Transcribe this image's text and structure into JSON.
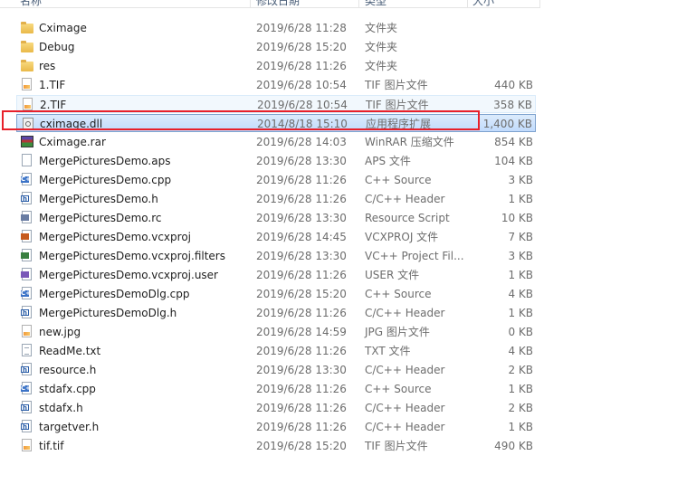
{
  "header": {
    "name": "名称",
    "date": "修改日期",
    "type": "类型",
    "size": "大小"
  },
  "files": [
    {
      "name": "Cximage",
      "date": "2019/6/28 11:28",
      "type": "文件夹",
      "size": "",
      "icon": "folder-icon"
    },
    {
      "name": "Debug",
      "date": "2019/6/28 15:20",
      "type": "文件夹",
      "size": "",
      "icon": "folder-icon"
    },
    {
      "name": "res",
      "date": "2019/6/28 11:26",
      "type": "文件夹",
      "size": "",
      "icon": "folder-icon"
    },
    {
      "name": "1.TIF",
      "date": "2019/6/28 10:54",
      "type": "TIF 图片文件",
      "size": "440 KB",
      "icon": "tif-image-icon"
    },
    {
      "name": "2.TIF",
      "date": "2019/6/28 10:54",
      "type": "TIF 图片文件",
      "size": "358 KB",
      "icon": "tif-image-icon"
    },
    {
      "name": "cximage.dll",
      "date": "2014/8/18 15:10",
      "type": "应用程序扩展",
      "size": "1,400 KB",
      "icon": "dll-icon"
    },
    {
      "name": "Cximage.rar",
      "date": "2019/6/28 14:03",
      "type": "WinRAR 压缩文件",
      "size": "854 KB",
      "icon": "rar-archive-icon"
    },
    {
      "name": "MergePicturesDemo.aps",
      "date": "2019/6/28 13:30",
      "type": "APS 文件",
      "size": "104 KB",
      "icon": "generic-file-icon"
    },
    {
      "name": "MergePicturesDemo.cpp",
      "date": "2019/6/28 11:26",
      "type": "C++ Source",
      "size": "3 KB",
      "icon": "cpp-source-icon"
    },
    {
      "name": "MergePicturesDemo.h",
      "date": "2019/6/28 11:26",
      "type": "C/C++ Header",
      "size": "1 KB",
      "icon": "header-file-icon"
    },
    {
      "name": "MergePicturesDemo.rc",
      "date": "2019/6/28 13:30",
      "type": "Resource Script",
      "size": "10 KB",
      "icon": "resource-script-icon"
    },
    {
      "name": "MergePicturesDemo.vcxproj",
      "date": "2019/6/28 14:45",
      "type": "VCXPROJ 文件",
      "size": "7 KB",
      "icon": "vcxproj-icon"
    },
    {
      "name": "MergePicturesDemo.vcxproj.filters",
      "date": "2019/6/28 13:30",
      "type": "VC++ Project Fil...",
      "size": "3 KB",
      "icon": "project-filters-icon"
    },
    {
      "name": "MergePicturesDemo.vcxproj.user",
      "date": "2019/6/28 11:26",
      "type": "USER 文件",
      "size": "1 KB",
      "icon": "vs-user-icon"
    },
    {
      "name": "MergePicturesDemoDlg.cpp",
      "date": "2019/6/28 15:20",
      "type": "C++ Source",
      "size": "4 KB",
      "icon": "cpp-source-icon"
    },
    {
      "name": "MergePicturesDemoDlg.h",
      "date": "2019/6/28 11:26",
      "type": "C/C++ Header",
      "size": "1 KB",
      "icon": "header-file-icon"
    },
    {
      "name": "new.jpg",
      "date": "2019/6/28 14:59",
      "type": "JPG 图片文件",
      "size": "0 KB",
      "icon": "jpg-image-icon"
    },
    {
      "name": "ReadMe.txt",
      "date": "2019/6/28 11:26",
      "type": "TXT 文件",
      "size": "4 KB",
      "icon": "text-file-icon"
    },
    {
      "name": "resource.h",
      "date": "2019/6/28 13:30",
      "type": "C/C++ Header",
      "size": "2 KB",
      "icon": "header-file-icon"
    },
    {
      "name": "stdafx.cpp",
      "date": "2019/6/28 11:26",
      "type": "C++ Source",
      "size": "1 KB",
      "icon": "cpp-source-icon"
    },
    {
      "name": "stdafx.h",
      "date": "2019/6/28 11:26",
      "type": "C/C++ Header",
      "size": "2 KB",
      "icon": "header-file-icon"
    },
    {
      "name": "targetver.h",
      "date": "2019/6/28 11:26",
      "type": "C/C++ Header",
      "size": "1 KB",
      "icon": "header-file-icon"
    },
    {
      "name": "tif.tif",
      "date": "2019/6/28 15:20",
      "type": "TIF 图片文件",
      "size": "490 KB",
      "icon": "tif-image-icon"
    }
  ],
  "state": {
    "hovered_row": 4,
    "selected_row": 5,
    "annotated_row": 5
  },
  "colors": {
    "annotation": "#e8202a",
    "selection": "#c1dbfc",
    "hover": "#f2f8fd"
  }
}
